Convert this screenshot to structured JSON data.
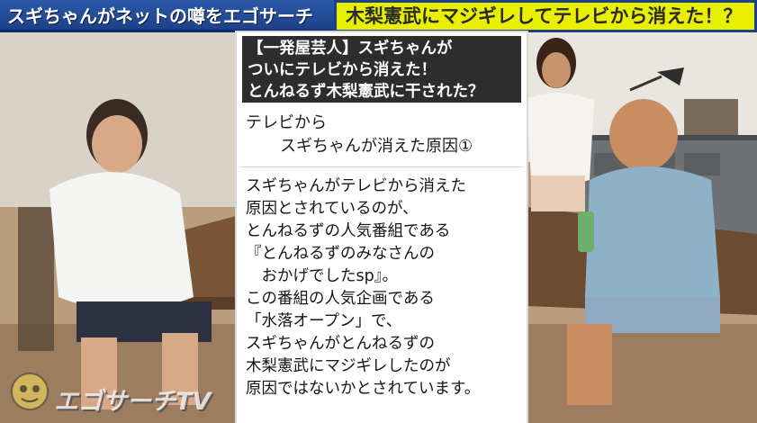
{
  "caption": {
    "left_text": "スギちゃんがネットの噂をエゴサーチ",
    "right_text": "木梨憲武にマジギレしてテレビから消えた！？"
  },
  "panel": {
    "title": "【一発屋芸人】スギちゃんが\nついにテレビから消えた！\nとんねるず木梨憲武に干された？",
    "subtitle_line1": "テレビから",
    "subtitle_line2": "スギちゃんが消えた原因①",
    "body": "スギちゃんがテレビから消えた\n原因とされているのが、\nとんねるずの人気番組である\n『とんねるずのみなさんの\n　おかげでしたsp』。\nこの番組の人気企画である\n「水落オープン」で、\nスギちゃんがとんねるずの\n木梨憲武にマジギレしたのが\n原因ではないかとされています。"
  },
  "watermark": {
    "text": "エゴサーチTV"
  }
}
